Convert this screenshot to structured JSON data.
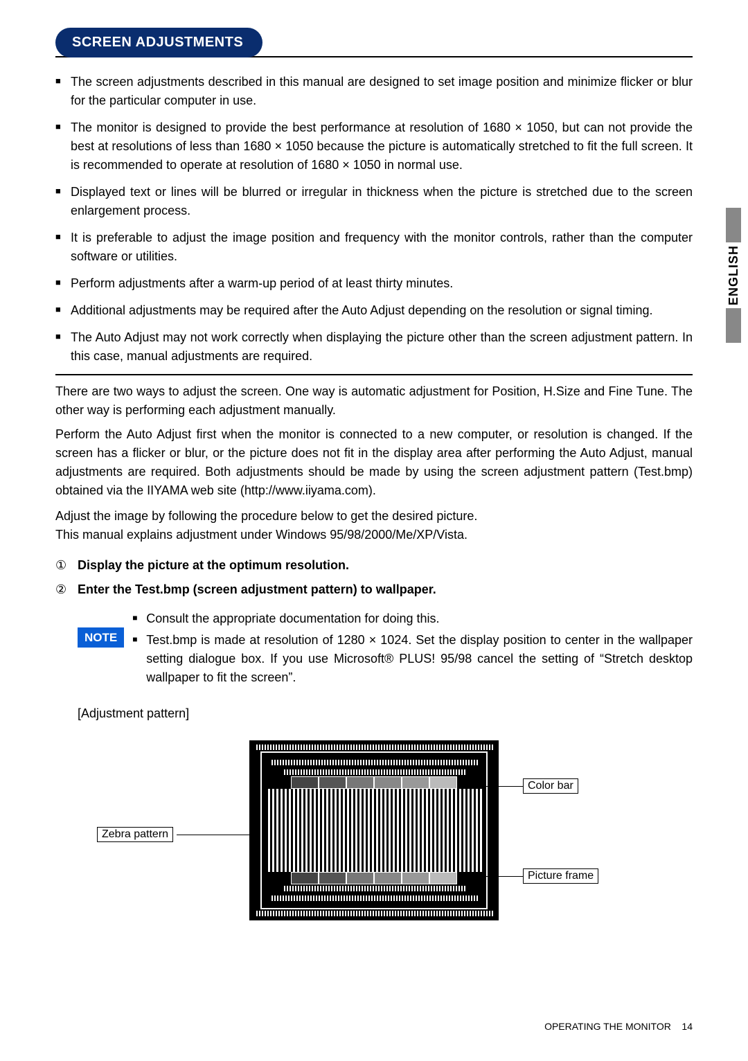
{
  "side_tab": {
    "label": "ENGLISH"
  },
  "header": {
    "title": "SCREEN ADJUSTMENTS"
  },
  "bullets": [
    "The screen adjustments described in this manual are designed to set image position and minimize flicker or blur for the particular computer in use.",
    "The monitor is designed to provide the best performance at resolution of 1680 × 1050, but can not provide the best at resolutions of less than 1680 × 1050 because the picture is automatically stretched to fit the full screen. It is recommended to operate at resolution of 1680 × 1050 in normal use.",
    "Displayed text or lines will be blurred or irregular in thickness when the picture is stretched due to the screen enlargement process.",
    "It is preferable to adjust the image position and frequency with the monitor controls, rather than the computer software or utilities.",
    "Perform adjustments after a warm-up period of at least thirty minutes.",
    "Additional adjustments may be required after the Auto Adjust depending on the resolution or signal timing.",
    "The Auto Adjust may not work correctly when displaying the picture other than the screen adjustment pattern. In this case, manual adjustments are required."
  ],
  "paragraphs": {
    "p1": "There are two ways to adjust the screen. One way is automatic adjustment for Position, H.Size and Fine Tune. The other way is performing each adjustment manually.",
    "p2": "Perform the Auto Adjust first when the monitor is connected to a new computer, or resolution is changed. If the screen has a flicker or blur, or the picture does not fit in the display area after performing the Auto Adjust, manual adjustments are required. Both adjustments should be made by using the screen adjustment pattern (Test.bmp) obtained via the IIYAMA web site (http://www.iiyama.com).",
    "p3": "Adjust the image by following the procedure below to get the desired picture.",
    "p4": "This manual explains adjustment under Windows 95/98/2000/Me/XP/Vista."
  },
  "steps": {
    "n1": "①",
    "t1": "Display the picture at the optimum resolution.",
    "n2": "②",
    "t2": "Enter the Test.bmp (screen adjustment pattern) to wallpaper."
  },
  "note": {
    "badge": "NOTE",
    "items": [
      "Consult the appropriate documentation for doing this.",
      "Test.bmp is made at resolution of 1280 × 1024. Set the display position to center in the wallpaper setting dialogue box. If you use Microsoft® PLUS! 95/98 cancel the setting of “Stretch desktop wallpaper to fit the screen”."
    ]
  },
  "figure": {
    "caption": "[Adjustment pattern]",
    "labels": {
      "zebra": "Zebra pattern",
      "colorbar": "Color bar",
      "pictureframe": "Picture frame"
    }
  },
  "footer": {
    "section": "OPERATING THE MONITOR",
    "page": "14"
  }
}
